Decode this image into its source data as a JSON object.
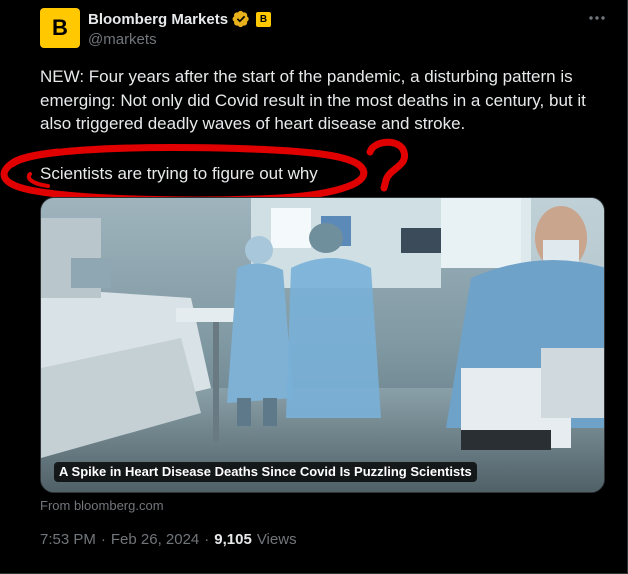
{
  "author": {
    "display_name": "Bloomberg Markets",
    "handle": "@markets",
    "avatar_letter": "B",
    "affiliate_letter": "B",
    "brand_color": "#ffc800",
    "verified_color": "#e8b11c"
  },
  "icons": {
    "more": "more-horizontal-icon",
    "verified": "verified-badge-icon"
  },
  "tweet": {
    "text_main": "NEW: Four years after the start of the pandemic, a disturbing pattern is emerging: Not only did Covid result in the most deaths in a century, but it also triggered deadly waves of heart disease and stroke.",
    "text_highlight": "Scientists are trying to figure out why"
  },
  "annotation": {
    "question_mark": "?",
    "ink_color": "#e00000"
  },
  "card": {
    "caption": "A Spike in Heart Disease Deaths Since Covid Is Puzzling Scientists",
    "source": "From bloomberg.com"
  },
  "meta": {
    "time": "7:53 PM",
    "separator": "·",
    "date": "Feb 26, 2024",
    "views_count": "9,105",
    "views_label": "Views"
  }
}
